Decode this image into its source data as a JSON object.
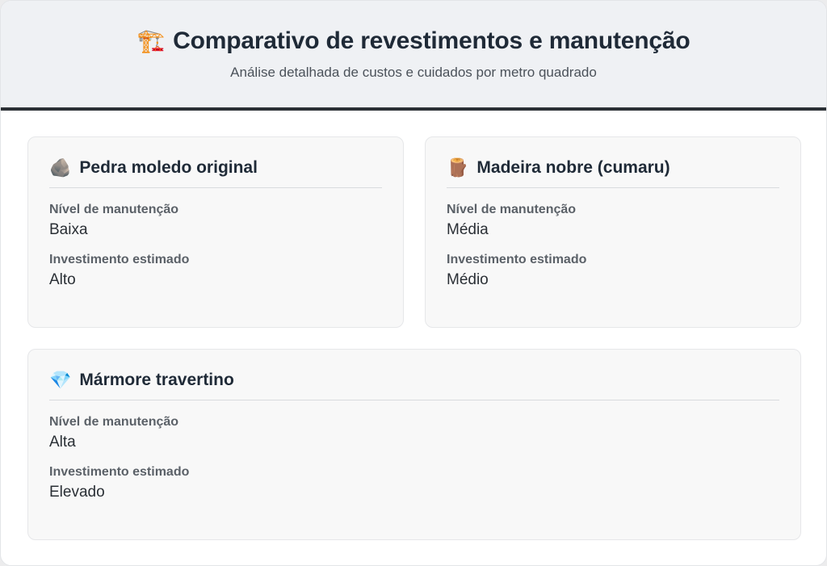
{
  "header": {
    "icon": "construction-crane-icon",
    "title_emoji": "🏗️",
    "title": "Comparativo de revestimentos e manutenção",
    "subtitle": "Análise detalhada de custos e cuidados por metro quadrado"
  },
  "cards": [
    {
      "icon": "rock-icon",
      "emoji": "🪨",
      "title": "Pedra moledo original",
      "maintenance_label": "Nível de manutenção",
      "maintenance_value": "Baixa",
      "investment_label": "Investimento estimado",
      "investment_value": "Alto"
    },
    {
      "icon": "wood-log-icon",
      "emoji": "🪵",
      "title": "Madeira nobre (cumaru)",
      "maintenance_label": "Nível de manutenção",
      "maintenance_value": "Média",
      "investment_label": "Investimento estimado",
      "investment_value": "Médio"
    },
    {
      "icon": "gem-icon",
      "emoji": "💎",
      "title": "Mármore travertino",
      "maintenance_label": "Nível de manutenção",
      "maintenance_value": "Alta",
      "investment_label": "Investimento estimado",
      "investment_value": "Elevado"
    }
  ]
}
